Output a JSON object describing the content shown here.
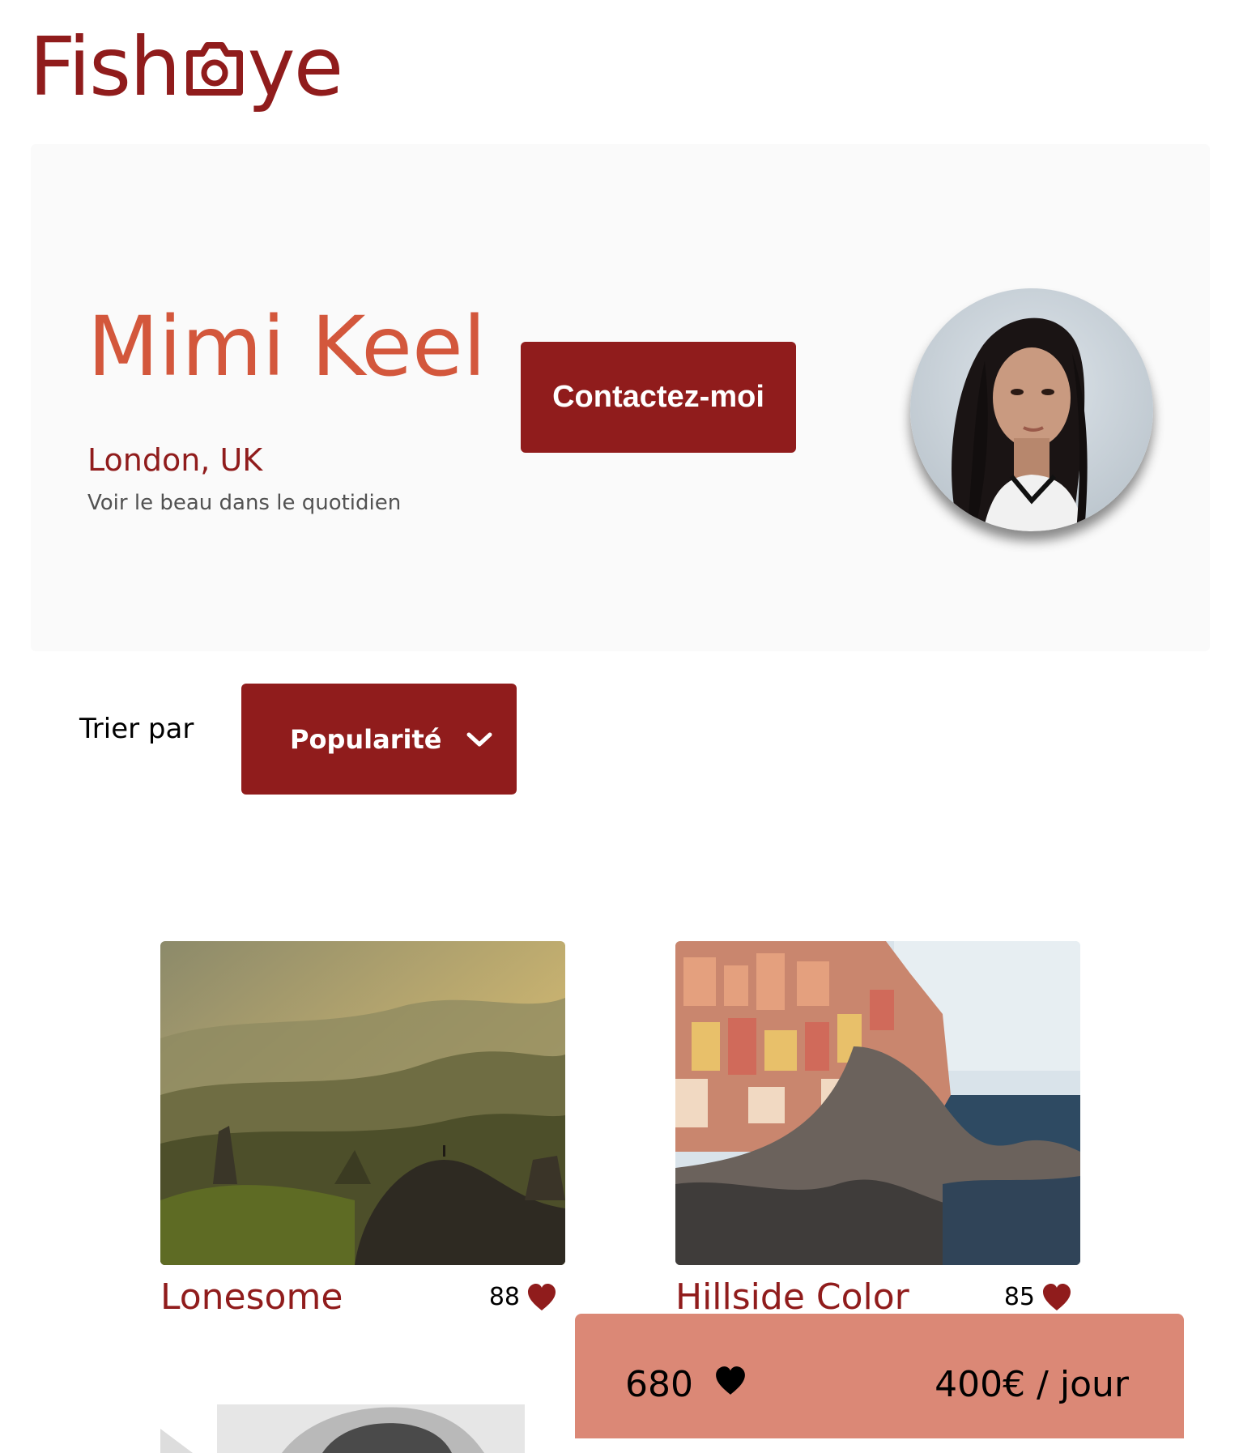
{
  "logo": {
    "prefix": "Fish",
    "suffix": "ye"
  },
  "photographer": {
    "name": "Mimi Keel",
    "location": "London, UK",
    "tagline": "Voir le beau dans le quotidien",
    "contact_label": "Contactez-moi"
  },
  "sort": {
    "label": "Trier par",
    "selected": "Popularité"
  },
  "media": [
    {
      "title": "Lonesome",
      "likes": "88"
    },
    {
      "title": "Hillside Color",
      "likes": "85"
    },
    {
      "title": "",
      "likes": ""
    }
  ],
  "stats": {
    "total_likes": "680",
    "price": "400€ / jour"
  },
  "colors": {
    "brand": "#901C1C",
    "name_accent": "#D3573C",
    "stats_bg": "#DB8876",
    "panel_bg": "#FAFAFA"
  },
  "icons": {
    "logo": "camera-icon",
    "sort": "chevron-down-icon",
    "like": "heart-icon"
  }
}
